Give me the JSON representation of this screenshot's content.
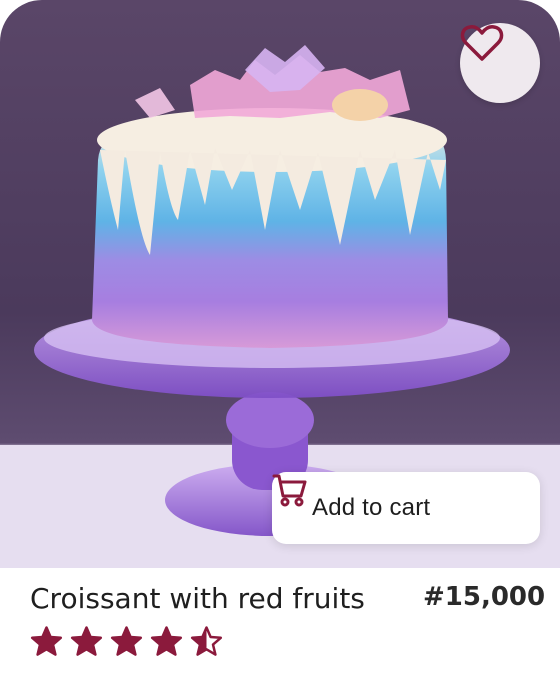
{
  "product": {
    "name": "Croissant with red fruits",
    "price": "#15,000",
    "rating": 4.5,
    "rating_max": 5
  },
  "actions": {
    "add_to_cart_label": "Add to cart",
    "favorite_icon": "heart-icon",
    "cart_icon": "cart-icon"
  },
  "colors": {
    "accent": "#8b1a3c",
    "card_bg": "#ffffff",
    "text": "#1f1f1f"
  }
}
